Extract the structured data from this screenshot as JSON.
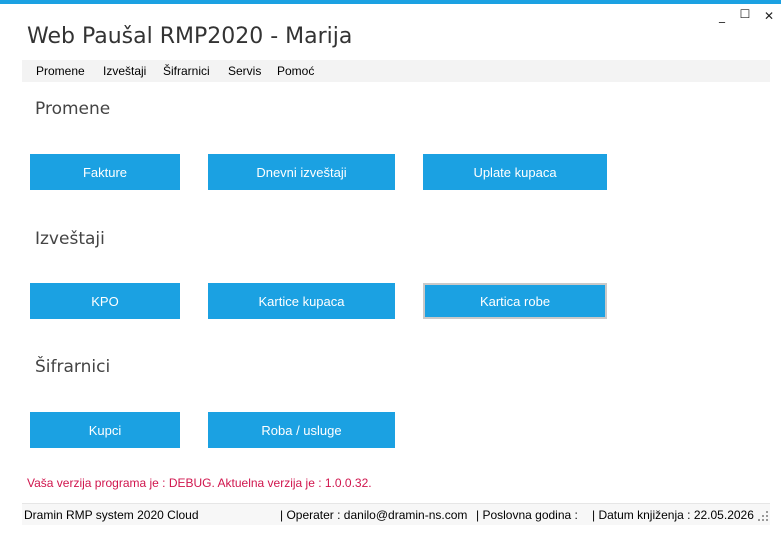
{
  "window": {
    "title": "Web Paušal RMP2020 - Marija",
    "minimize": "_",
    "maximize": "☐",
    "close": "✕"
  },
  "menu": [
    "Promene",
    "Izveštaji",
    "Šifrarnici",
    "Servis",
    "Pomoć"
  ],
  "sections": [
    {
      "title": "Promene",
      "buttons": [
        "Fakture",
        "Dnevni izveštaji",
        "Uplate kupaca"
      ]
    },
    {
      "title": "Izveštaji",
      "buttons": [
        "KPO",
        "Kartice kupaca",
        "Kartica robe"
      ]
    },
    {
      "title": "Šifrarnici",
      "buttons": [
        "Kupci",
        "Roba / usluge"
      ]
    }
  ],
  "version_message": "Vaša verzija programa je : DEBUG. Aktuelna verzija je : 1.0.0.32.",
  "status": {
    "app": "Dramin RMP system 2020 Cloud",
    "operater": "|  Operater : danilo@dramin-ns.com",
    "godina": "|  Poslovna godina :",
    "datum": "|  Datum knjiženja : 22.05.2026"
  },
  "colors": {
    "accent": "#1ba1e2",
    "warning_text": "#d0154d"
  }
}
